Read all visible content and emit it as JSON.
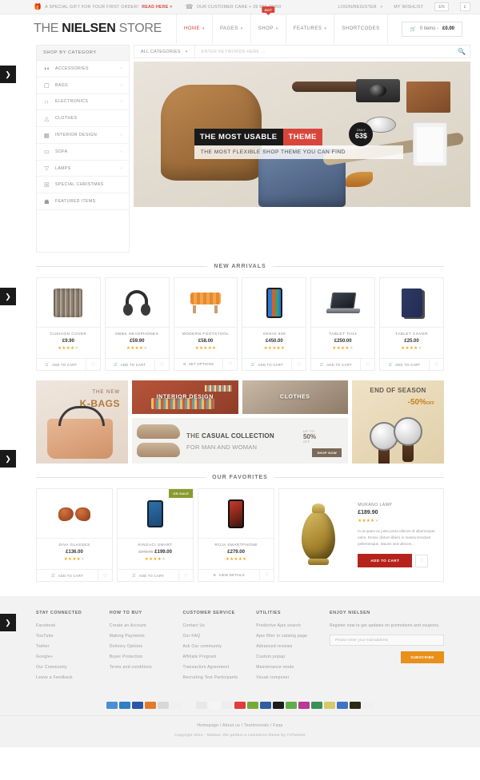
{
  "topbar": {
    "gift_icon": "gift-icon",
    "promo_text": "A SPECIAL GIFT FOR YOUR FIRST ORDER!",
    "promo_link": "READ HERE >",
    "phone_icon": "phone-icon",
    "care_text": "OUR CUSTOMER CARE + 39 800 28300",
    "login": "LOGIN/REGISTER",
    "wishlist": "MY WISHLIST",
    "lang": "EN",
    "currency": "£"
  },
  "header": {
    "logo_pre": "THE ",
    "logo_bold": "NIELSEN",
    "logo_post": " STORE",
    "nav": [
      {
        "label": "HOME",
        "caret": true,
        "active": true,
        "badge": ""
      },
      {
        "label": "PAGES",
        "caret": true,
        "active": false,
        "badge": ""
      },
      {
        "label": "SHOP",
        "caret": true,
        "active": false,
        "badge": "HOT"
      },
      {
        "label": "FEATURES",
        "caret": true,
        "active": false,
        "badge": ""
      },
      {
        "label": "SHORTCODES",
        "caret": false,
        "active": false,
        "badge": ""
      }
    ],
    "cart_icon": "cart-icon",
    "cart_count": "0 items - ",
    "cart_total": "£0.00"
  },
  "sidebar": {
    "title": "SHOP BY CATEGORY",
    "items": [
      {
        "label": "ACCESSORIES",
        "icon": "glasses-icon",
        "glyph": "◑◐",
        "arrow": true
      },
      {
        "label": "BAGS",
        "icon": "bag-icon",
        "glyph": "▢",
        "arrow": true
      },
      {
        "label": "ELECTRONICS",
        "icon": "headphones-icon",
        "glyph": "∩",
        "arrow": true
      },
      {
        "label": "CLOTHES",
        "icon": "tshirt-icon",
        "glyph": "△",
        "arrow": false
      },
      {
        "label": "INTERIOR DESIGN",
        "icon": "cabinet-icon",
        "glyph": "▦",
        "arrow": true
      },
      {
        "label": "SOFA",
        "icon": "sofa-icon",
        "glyph": "▭",
        "arrow": true
      },
      {
        "label": "LAMPS",
        "icon": "lamp-icon",
        "glyph": "▽",
        "arrow": true
      },
      {
        "label": "SPECIAL CHRISTMAS",
        "icon": "gift-icon",
        "glyph": "☒",
        "arrow": false
      },
      {
        "label": "FEATURED ITEMS",
        "icon": "trophy-icon",
        "glyph": "☗",
        "arrow": false
      }
    ]
  },
  "search": {
    "category_label": "ALL CATEGORIES",
    "placeholder": "ENTER KEYWORDS HERE ...",
    "button_icon": "search-icon"
  },
  "hero": {
    "title_dark": "THE MOST USABLE",
    "title_red": "THEME",
    "subtitle": "THE MOST FLEXIBLE SHOP THEME YOU CAN FIND",
    "badge_top": "ONLY",
    "badge_price": "63$"
  },
  "sections": {
    "new_arrivals": "NEW ARRIVALS",
    "our_favorites": "OUR FAVORITES"
  },
  "new_arrivals": [
    {
      "name": "CUSHION COVER",
      "price": "£9.90",
      "old_price": "",
      "stars": 4,
      "action": "ADD TO CART",
      "action_icon": "cart-icon",
      "art": "p-pillow",
      "badge": ""
    },
    {
      "name": "DBBS HEADPHONES",
      "price": "£59.90",
      "old_price": "",
      "stars": 4,
      "action": "ADD TO CART",
      "action_icon": "cart-icon",
      "art": "p-head",
      "badge": ""
    },
    {
      "name": "MODERN FOOTSTOOL",
      "price": "£58.00",
      "old_price": "",
      "stars": 5,
      "action": "SET OPTIONS",
      "action_icon": "options-icon",
      "art": "p-stool",
      "badge": ""
    },
    {
      "name": "OKKIO 600",
      "price": "£450.00",
      "old_price": "",
      "stars": 5,
      "action": "ADD TO CART",
      "action_icon": "cart-icon",
      "art": "p-phone",
      "badge": ""
    },
    {
      "name": "TABLET TH14",
      "price": "£250.00",
      "old_price": "",
      "stars": 4,
      "action": "ADD TO CART",
      "action_icon": "cart-icon",
      "art": "p-laptop",
      "badge": ""
    },
    {
      "name": "TABLET COVER",
      "price": "£25.00",
      "old_price": "",
      "stars": 4,
      "action": "ADD TO CART",
      "action_icon": "cart-icon",
      "art": "p-cover",
      "badge": ""
    }
  ],
  "favorites": [
    {
      "name": "DIVA GLASSES",
      "price": "£136.00",
      "old_price": "",
      "stars": 4,
      "action": "ADD TO CART",
      "action_icon": "cart-icon",
      "art": "p-glass",
      "badge": ""
    },
    {
      "name": "KINGACI SMART",
      "price": "£199.00",
      "old_price": "£249.00",
      "stars": 4,
      "action": "ADD TO CART",
      "action_icon": "cart-icon",
      "art": "p-sphone",
      "badge": "ON SALE"
    },
    {
      "name": "ROJA SMARTPHONE",
      "price": "£279.00",
      "old_price": "",
      "stars": 5,
      "action": "VIEW DETAILS",
      "action_icon": "options-icon",
      "art": "p-rphone",
      "badge": ""
    }
  ],
  "featured_product": {
    "name": "MURANO LAMP",
    "price": "£189.90",
    "stars": 4,
    "description": "In at quam ac justo porta ultrices id ullamcorper enim. Donec dictum libero in massa tincidunt pellentesque. Mauris sed ultrices...",
    "button": "ADD TO CART",
    "wishlist_icon": "heart-icon"
  },
  "banners": {
    "kbags_top": "THE NEW",
    "kbags_main": "K-BAGS",
    "interior": "INTERIOR DESIGN",
    "clothes": "CLOTHES",
    "casual_main_1": "THE ",
    "casual_main_2": "CASUAL COLLECTION",
    "casual_sub": "FOR MAN AND WOMAN",
    "upto": "UP TO",
    "upto_value": "50%",
    "upto_off": "OFF",
    "shop_now": "SHOP NOW",
    "season_title": "END OF SEASON",
    "season_value": "-50%",
    "season_off": "OFF"
  },
  "footer": {
    "columns": [
      {
        "title": "STAY CONNECTED",
        "links": [
          "Facebook",
          "YouTube",
          "Twitter",
          "Google+",
          "Our Community",
          "Leave a Feedback"
        ]
      },
      {
        "title": "HOW TO BUY",
        "links": [
          "Create an Account",
          "Making Payments",
          "Delivery Options",
          "Buyer Protection",
          "Terms and conditions"
        ]
      },
      {
        "title": "CUSTOMER SERVICE",
        "links": [
          "Contact Us",
          "Our FAQ",
          "Ask Our community",
          "Affiliate Program",
          "Transaction Agreement",
          "Recruiting Test Participants"
        ]
      },
      {
        "title": "UTILITIES",
        "links": [
          "Predictive Ajax search",
          "Ajax filter in catalog page",
          "Advanced reviews",
          "Custom popup",
          "Maintenance mode",
          "Visual composer"
        ]
      }
    ],
    "newsletter": {
      "title": "ENJOY NIELSEN",
      "text": "Register now to get updates on promotions and coupons.",
      "placeholder": "Please enter your mail address",
      "button": "SUBSCRIBE"
    },
    "payment_icons": [
      {
        "name": "visa-icon",
        "color": "#4a8fd4"
      },
      {
        "name": "amex-icon",
        "color": "#2f7fc1"
      },
      {
        "name": "maestro-icon",
        "color": "#2b55a8"
      },
      {
        "name": "discover-icon",
        "color": "#e07b2a"
      },
      {
        "name": "cirrus-icon",
        "color": "#d8d8d8"
      },
      {
        "name": "diners-icon",
        "color": "#f0f0f0"
      },
      {
        "name": "skrill-icon",
        "color": "#f2f2f2"
      },
      {
        "name": "mastercard-icon",
        "color": "#e8e8e8"
      },
      {
        "name": "mastercard2-icon",
        "color": "#f5f5f5"
      },
      {
        "name": "laser-icon",
        "color": "#ededed"
      },
      {
        "name": "solo-icon",
        "color": "#e03c3c"
      },
      {
        "name": "westernunion-icon",
        "color": "#79a83a"
      },
      {
        "name": "paypal-icon",
        "color": "#2f5f9e"
      },
      {
        "name": "blackcard-icon",
        "color": "#1c1c1c"
      },
      {
        "name": "ukash-icon",
        "color": "#5fae4a"
      },
      {
        "name": "moneybookers-icon",
        "color": "#b63a96"
      },
      {
        "name": "greencard-icon",
        "color": "#3c8f5a"
      },
      {
        "name": "cash-icon",
        "color": "#d6c96a"
      },
      {
        "name": "bluecard-icon",
        "color": "#3f74c4"
      },
      {
        "name": "goldcard-icon",
        "color": "#2a2a16"
      },
      {
        "name": "generic-icon",
        "color": "#f0f0f0"
      }
    ],
    "bottom_links": "Homepage / About us / Testimonials / Faqs",
    "copyright": "Copyright 2014 - Nielsen, the perfect e-commerce theme by YIThemes"
  },
  "side_tabs": [
    {
      "name": "slider-arrow-1",
      "glyph": "❯"
    },
    {
      "name": "slider-arrow-2",
      "glyph": "❯"
    },
    {
      "name": "slider-arrow-3",
      "glyph": "❯"
    },
    {
      "name": "slider-arrow-4",
      "glyph": "❯"
    }
  ]
}
